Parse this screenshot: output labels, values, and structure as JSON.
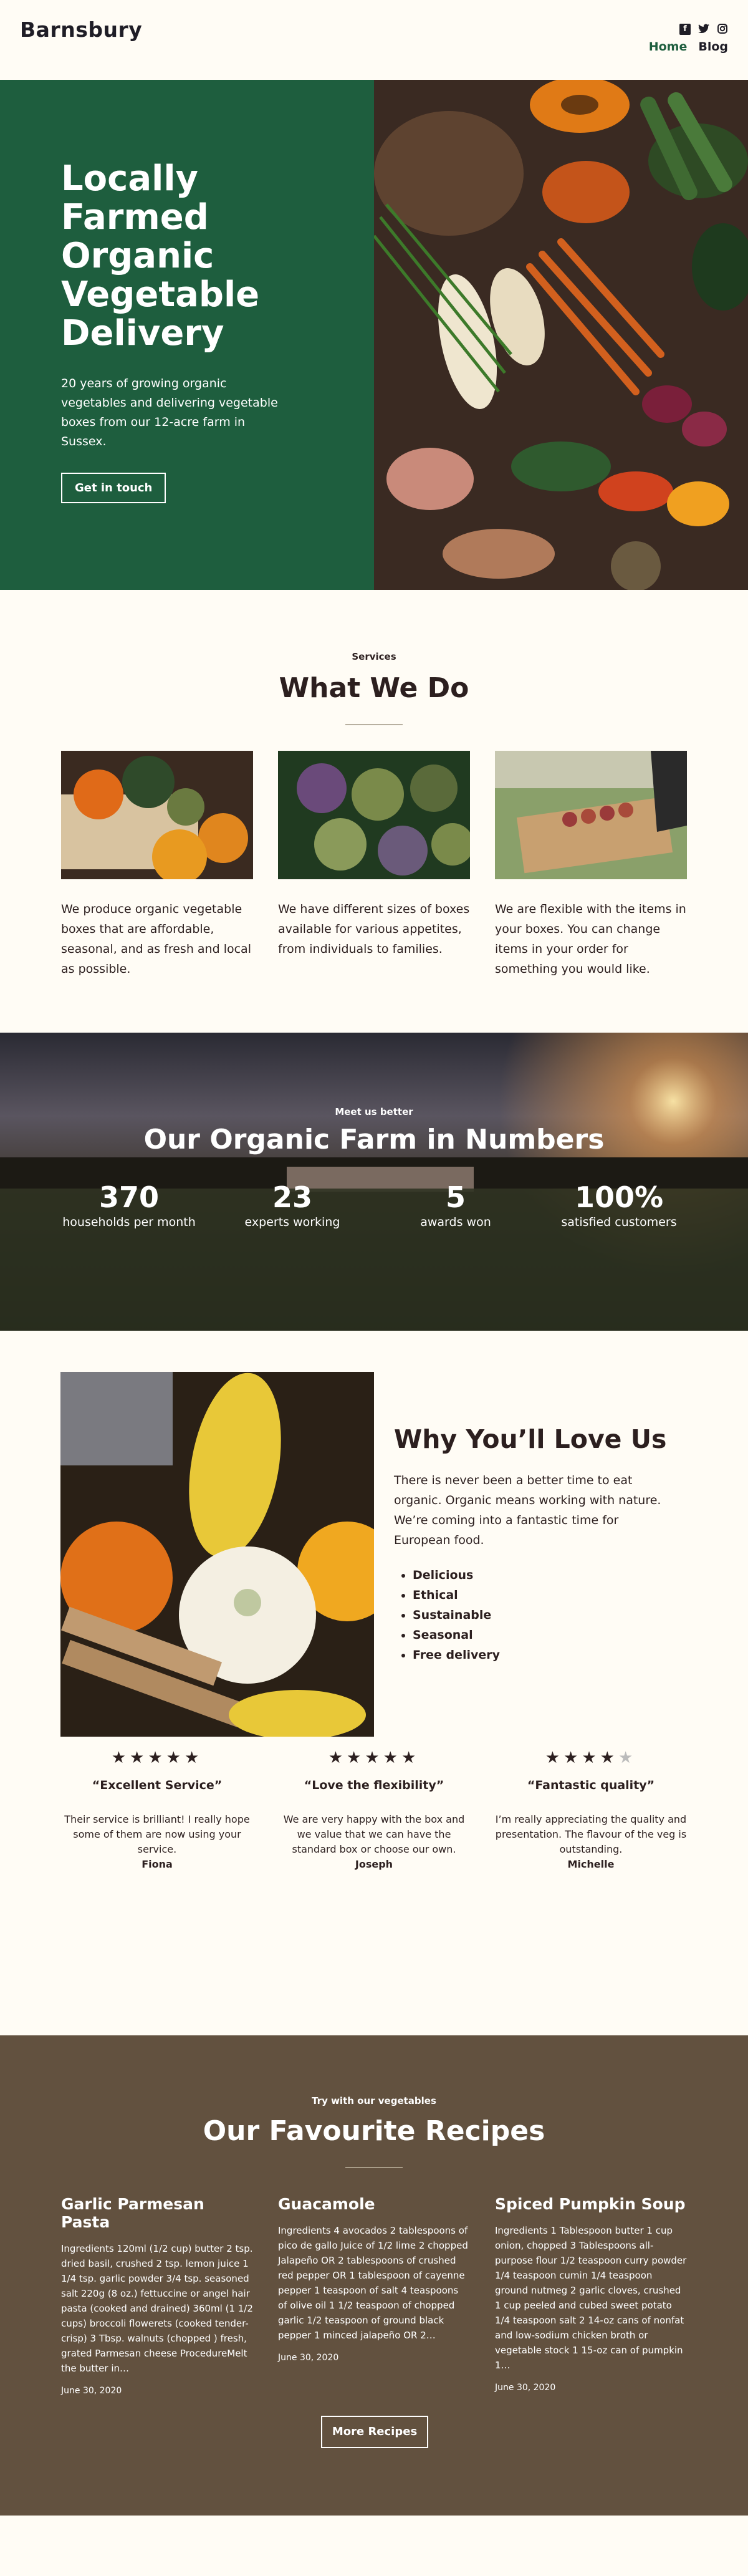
{
  "header": {
    "logo": "Barnsbury",
    "social": [
      "facebook-icon",
      "twitter-icon",
      "instagram-icon"
    ],
    "nav": [
      {
        "label": "Home",
        "active": true
      },
      {
        "label": "Blog",
        "active": false
      }
    ]
  },
  "hero": {
    "title": "Locally Farmed Organic Vegetable Delivery",
    "subtitle": "20 years of growing organic vegetables and delivering vegetable boxes from our 12-acre farm in Sussex.",
    "cta": "Get in touch"
  },
  "services": {
    "eyebrow": "Services",
    "title": "What We Do",
    "cards": [
      {
        "text": "We produce organic vegetable boxes that are affordable, seasonal, and as fresh and local as possible."
      },
      {
        "text": "We have different sizes of boxes available for various appetites, from individuals to families."
      },
      {
        "text": "We are flexible with the items in your boxes. You can change items in your order for something you would like."
      }
    ]
  },
  "stats": {
    "eyebrow": "Meet us better",
    "title": "Our Organic Farm in Numbers",
    "items": [
      {
        "value": "370",
        "label": "households per month"
      },
      {
        "value": "23",
        "label": "experts working"
      },
      {
        "value": "5",
        "label": "awards won"
      },
      {
        "value": "100%",
        "label": "satisfied customers"
      }
    ]
  },
  "why": {
    "title": "Why You’ll Love Us",
    "paragraph": "There is never been a better time to eat organic. Organic means working with nature. We’re coming into a fantastic time for European food.",
    "list": [
      "Delicious",
      "Ethical",
      "Sustainable",
      "Seasonal",
      "Free delivery"
    ]
  },
  "testimonials": [
    {
      "rating": 5,
      "title": "“Excellent Service”",
      "text": "Their service is brilliant! I really hope some of them are now using your service.",
      "name": "Fiona"
    },
    {
      "rating": 5,
      "title": "“Love the flexibility”",
      "text": "We are very happy with the box and we value that we can have the standard box or choose our own.",
      "name": "Joseph"
    },
    {
      "rating": 4,
      "title": "“Fantastic quality”",
      "text": "I’m really appreciating the quality and presentation. The flavour of the veg is outstanding.",
      "name": "Michelle"
    }
  ],
  "recipes": {
    "eyebrow": "Try with our vegetables",
    "title": "Our Favourite Recipes",
    "items": [
      {
        "title": "Garlic Parmesan Pasta",
        "body": "Ingredients 120ml (1/2 cup) butter 2 tsp. dried basil, crushed 2 tsp. lemon juice 1 1/4 tsp. garlic powder 3/4 tsp. seasoned salt 220g (8 oz.) fettuccine or angel hair pasta (cooked and drained) 360ml (1 1/2 cups) broccoli flowerets (cooked tender-crisp) 3 Tbsp. walnuts (chopped ) fresh, grated Parmesan cheese ProcedureMelt the butter in…",
        "date": "June 30, 2020"
      },
      {
        "title": "Guacamole",
        "body": "Ingredients 4 avocados 2 tablespoons of pico de gallo Juice of 1/2 lime 2 chopped Jalapeño OR 2 tablespoons of crushed red pepper OR 1 tablespoon of cayenne pepper 1 teaspoon of salt 4 teaspoons of olive oil 1 1/2 teaspoon of chopped garlic 1/2 teaspoon of ground black pepper 1 minced jalapeño OR 2…",
        "date": "June 30, 2020"
      },
      {
        "title": "Spiced Pumpkin Soup",
        "body": "Ingredients 1 Tablespoon butter 1 cup onion, chopped 3 Tablespoons all-purpose flour 1/2 teaspoon curry powder 1/4 teaspoon cumin 1/4 teaspoon ground nutmeg 2 garlic cloves, crushed 1 cup peeled and cubed sweet potato 1/4 teaspoon salt 2 14-oz cans of nonfat and low-sodium chicken broth or vegetable stock 1 15-oz can of pumpkin 1…",
        "date": "June 30, 2020"
      }
    ],
    "more": "More Recipes"
  }
}
